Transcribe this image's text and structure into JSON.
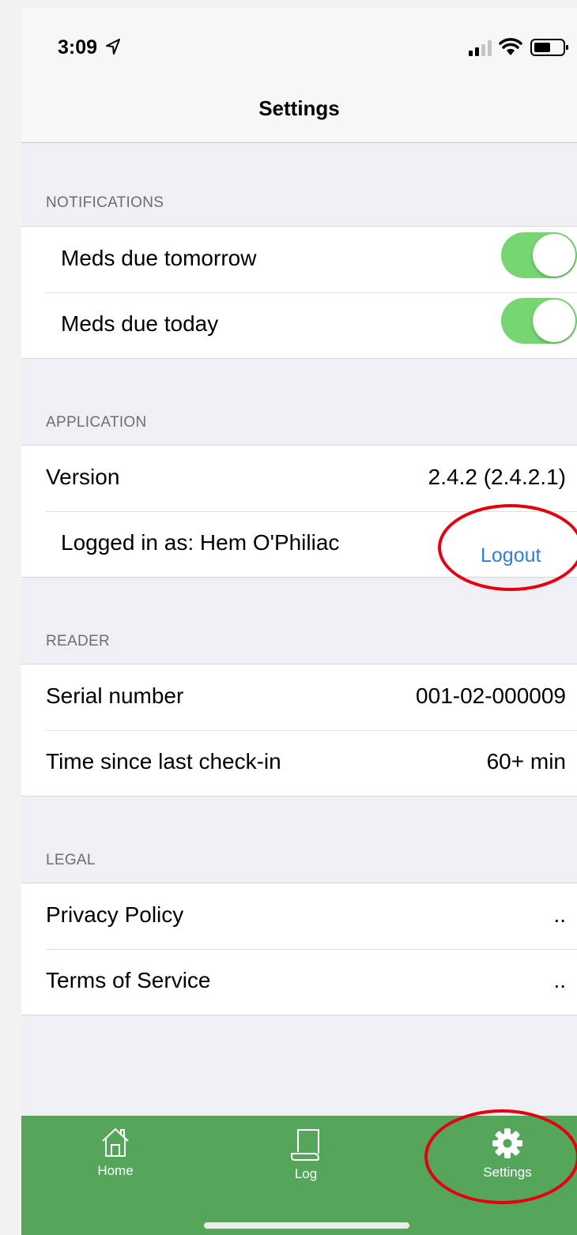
{
  "status_bar": {
    "time": "3:09",
    "location_icon": "location-arrow-icon",
    "signal_icon": "cellular-signal-icon",
    "wifi_icon": "wifi-icon",
    "battery_icon": "battery-icon"
  },
  "nav": {
    "title": "Settings"
  },
  "sections": {
    "notifications": {
      "header": "NOTIFICATIONS",
      "rows": [
        {
          "label": "Meds due tomorrow",
          "toggle_on": true
        },
        {
          "label": "Meds due today",
          "toggle_on": true
        }
      ]
    },
    "application": {
      "header": "APPLICATION",
      "version_label": "Version",
      "version_value": "2.4.2 (2.4.2.1)",
      "logged_in_label": "Logged in as: Hem O'Philiac",
      "logout_label": "Logout"
    },
    "reader": {
      "header": "READER",
      "serial_label": "Serial number",
      "serial_value": "001-02-000009",
      "checkin_label": "Time since last check-in",
      "checkin_value": "60+ min"
    },
    "legal": {
      "header": "LEGAL",
      "privacy_label": "Privacy Policy",
      "privacy_value": "..",
      "terms_label": "Terms of Service",
      "terms_value": ".."
    }
  },
  "tabbar": {
    "tabs": [
      {
        "label": "Home",
        "icon": "home-icon"
      },
      {
        "label": "Log",
        "icon": "scroll-icon"
      },
      {
        "label": "Settings",
        "icon": "gear-icon"
      }
    ]
  },
  "colors": {
    "accent_green": "#55a65b",
    "toggle_green": "#76d672",
    "link_blue": "#2f7fd9",
    "annotation_red": "#e3000f"
  }
}
